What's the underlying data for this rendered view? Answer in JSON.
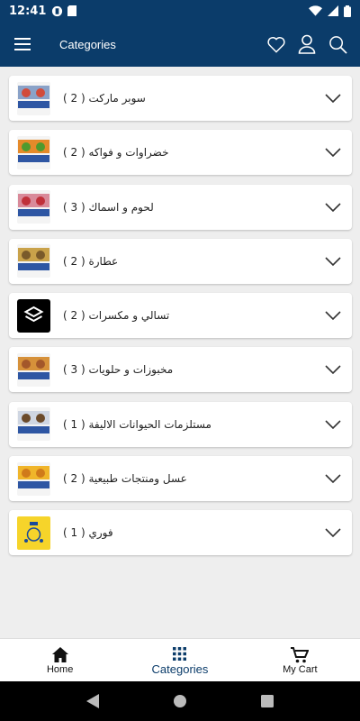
{
  "status_bar": {
    "time": "12:41"
  },
  "app_bar": {
    "title": "Categories"
  },
  "categories": [
    {
      "label": "سوبر ماركت ( 2 )",
      "thumb_colors": [
        "#8aa2c8",
        "#d24b3a",
        "#2e56a3"
      ]
    },
    {
      "label": "خضراوات و فواكه ( 2 )",
      "thumb_colors": [
        "#e58a2a",
        "#4e9a2e",
        "#2e56a3"
      ]
    },
    {
      "label": "لحوم و اسماك ( 3 )",
      "thumb_colors": [
        "#d98a9a",
        "#c0303a",
        "#2e56a3"
      ]
    },
    {
      "label": "عطارة ( 2 )",
      "thumb_colors": [
        "#c9a24a",
        "#7a5a2a",
        "#2e56a3"
      ]
    },
    {
      "label": "تسالي و مكسرات ( 2 )",
      "thumb_colors": [
        "#000000",
        "#ffffff",
        "#000000"
      ]
    },
    {
      "label": "مخبوزات و حلويات ( 3 )",
      "thumb_colors": [
        "#d6913a",
        "#a3572a",
        "#2e56a3"
      ]
    },
    {
      "label": "مستلزمات الحيوانات الاليفة ( 1 )",
      "thumb_colors": [
        "#cfd6e2",
        "#6b4a2a",
        "#2e56a3"
      ]
    },
    {
      "label": "عسل ومنتجات طبيعية ( 2 )",
      "thumb_colors": [
        "#f0b52a",
        "#d07a1a",
        "#2e56a3"
      ]
    },
    {
      "label": "فوري ( 1 )",
      "thumb_colors": [
        "#f6d42a",
        "#f6d42a",
        "#1a4a9a"
      ]
    }
  ],
  "bottom_nav": {
    "home": "Home",
    "categories": "Categories",
    "cart": "My Cart"
  },
  "colors": {
    "primary": "#0b3c6a",
    "background": "#eeeeee"
  }
}
